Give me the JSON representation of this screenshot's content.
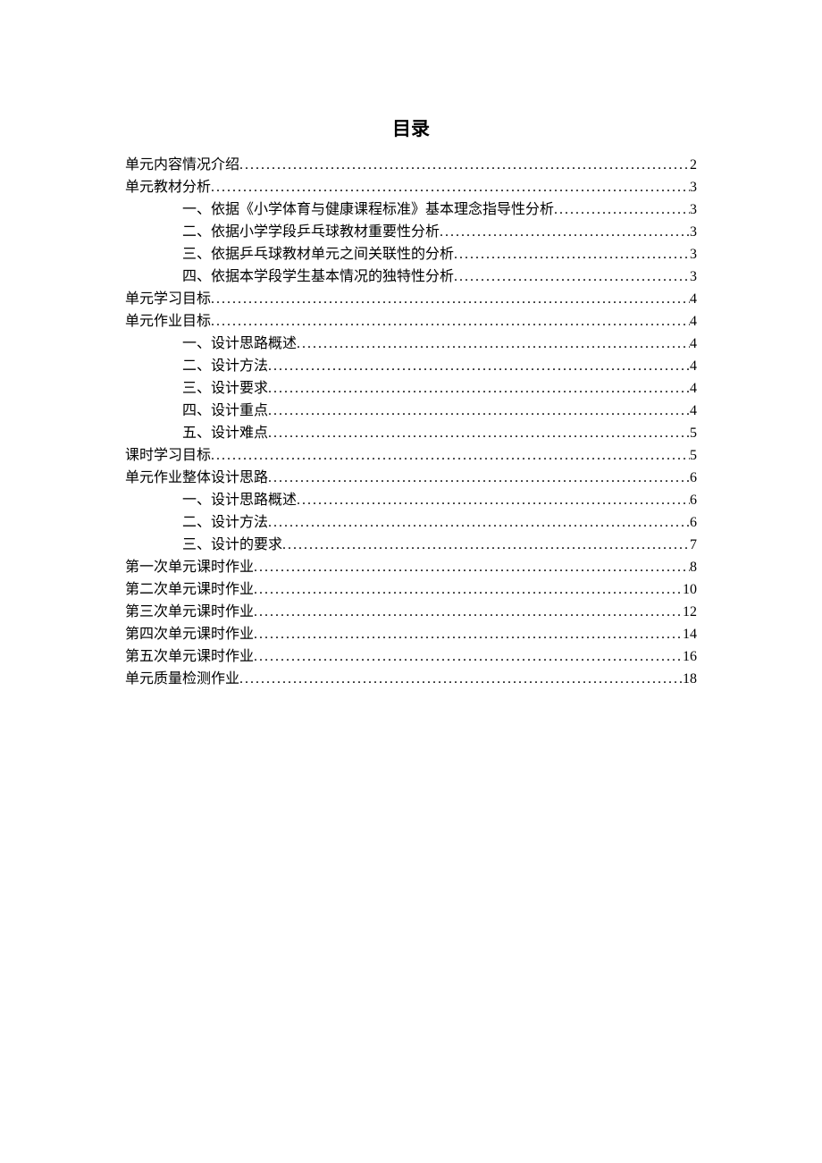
{
  "title": "目录",
  "entries": [
    {
      "level": 0,
      "label": "单元内容情况介绍",
      "page": "2"
    },
    {
      "level": 0,
      "label": "单元教材分析",
      "page": "3"
    },
    {
      "level": 1,
      "label": "一、依据《小学体育与健康课程标准》基本理念指导性分析",
      "page": "3"
    },
    {
      "level": 1,
      "label": "二、依据小学学段乒乓球教材重要性分析",
      "page": "3"
    },
    {
      "level": 1,
      "label": "三、依据乒乓球教材单元之间关联性的分析",
      "page": "3"
    },
    {
      "level": 1,
      "label": "四、依据本学段学生基本情况的独特性分析",
      "page": "3"
    },
    {
      "level": 0,
      "label": "单元学习目标",
      "page": "4"
    },
    {
      "level": 0,
      "label": "单元作业目标",
      "page": "4"
    },
    {
      "level": 1,
      "label": "一、设计思路概述",
      "page": "4"
    },
    {
      "level": 1,
      "label": "二、设计方法",
      "page": "4"
    },
    {
      "level": 1,
      "label": "三、设计要求",
      "page": "4"
    },
    {
      "level": 1,
      "label": "四、设计重点",
      "page": "4"
    },
    {
      "level": 1,
      "label": "五、设计难点",
      "page": "5"
    },
    {
      "level": 0,
      "label": "课时学习目标",
      "page": "5"
    },
    {
      "level": 0,
      "label": "单元作业整体设计思路",
      "page": "6"
    },
    {
      "level": 1,
      "label": "一、设计思路概述",
      "page": "6"
    },
    {
      "level": 1,
      "label": "二、设计方法",
      "page": "6"
    },
    {
      "level": 1,
      "label": "三、设计的要求",
      "page": "7"
    },
    {
      "level": 0,
      "label": "第一次单元课时作业",
      "page": "8"
    },
    {
      "level": 0,
      "label": "第二次单元课时作业",
      "page": "10"
    },
    {
      "level": 0,
      "label": "第三次单元课时作业",
      "page": "12"
    },
    {
      "level": 0,
      "label": "第四次单元课时作业",
      "page": "14"
    },
    {
      "level": 0,
      "label": "第五次单元课时作业",
      "page": "16"
    },
    {
      "level": 0,
      "label": "单元质量检测作业",
      "page": "18"
    }
  ]
}
